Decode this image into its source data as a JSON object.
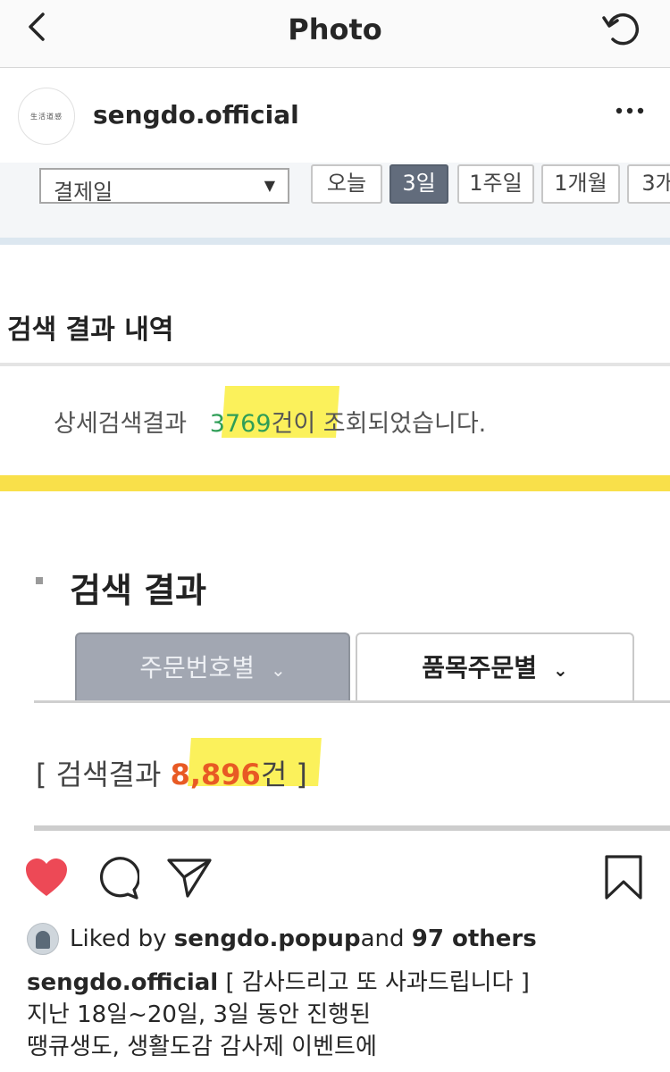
{
  "nav": {
    "title": "Photo"
  },
  "post": {
    "username": "sengdo.official",
    "avatar_text": "生活道感"
  },
  "photo": {
    "date_select": {
      "value": "결제일"
    },
    "date_buttons": [
      "오늘",
      "3일",
      "1주일",
      "1개월",
      "3개"
    ],
    "active_date_button": "3일",
    "section1_title": "검색 결과 내역",
    "result1": {
      "prefix": "상세검색결과",
      "count": "3769",
      "suffix": "건이 조회되었습니다."
    },
    "section2_title": "검색 결과",
    "tabs": [
      {
        "label": "주문번호별",
        "active": false
      },
      {
        "label": "품목주문별",
        "active": true
      }
    ],
    "result2": {
      "open": "[ 검색결과 ",
      "count": "8,896",
      "suffix": "건 ]"
    },
    "colors": {
      "highlight": "#fbf15b",
      "green_count": "#2f9e57",
      "orange_count": "#e85a24",
      "band": "#f9e04a"
    }
  },
  "actions": {
    "liked": true,
    "icons": [
      "heart-icon",
      "comment-icon",
      "share-icon",
      "bookmark-icon"
    ]
  },
  "likes": {
    "prefix": "Liked by ",
    "user": "sengdo.popup",
    "middle": " and ",
    "others": "97 others"
  },
  "caption": {
    "username": "sengdo.official",
    "line1": " [ 감사드리고 또 사과드립니다 ]",
    "line2": "지난 18일~20일, 3일 동안 진행된",
    "line3": "땡큐생도, 생활도감 감사제 이벤트에"
  }
}
